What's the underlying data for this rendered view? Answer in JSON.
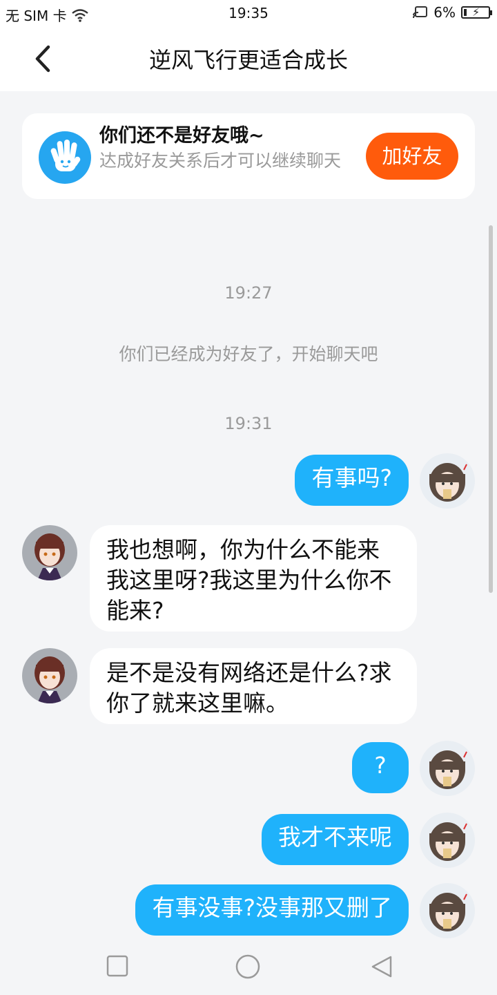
{
  "status_bar": {
    "carrier": "无 SIM 卡",
    "time": "19:35",
    "battery": "6%",
    "battery_level": 0.06
  },
  "header": {
    "title": "逆风飞行更适合成长",
    "back_icon": "chevron-left-icon"
  },
  "friend_prompt": {
    "title": "你们还不是好友哦~",
    "subtitle": "达成好友关系后才可以继续聊天",
    "button_label": "加好友",
    "icon": "hand-icon",
    "button_color": "#ff5b0c"
  },
  "chat": {
    "timestamp_1": "19:27",
    "system_message": "你们已经成为好友了，开始聊天吧",
    "timestamp_2": "19:31",
    "messages": [
      {
        "side": "out",
        "text": "有事吗?"
      },
      {
        "side": "in",
        "text": "我也想啊，你为什么不能来我这里呀?我这里为什么你不能来?"
      },
      {
        "side": "in",
        "text": "是不是没有网络还是什么?求你了就来这里嘛。"
      },
      {
        "side": "out",
        "text": "?"
      },
      {
        "side": "out",
        "text": "我才不来呢"
      },
      {
        "side": "out",
        "text": "有事没事?没事那又删了"
      }
    ]
  },
  "nav_bar": {
    "icons": [
      "square-icon",
      "circle-icon",
      "triangle-back-icon"
    ]
  },
  "colors": {
    "outgoing_bubble": "#1fb2fb",
    "incoming_bubble": "#ffffff",
    "background": "#f4f5f7"
  }
}
